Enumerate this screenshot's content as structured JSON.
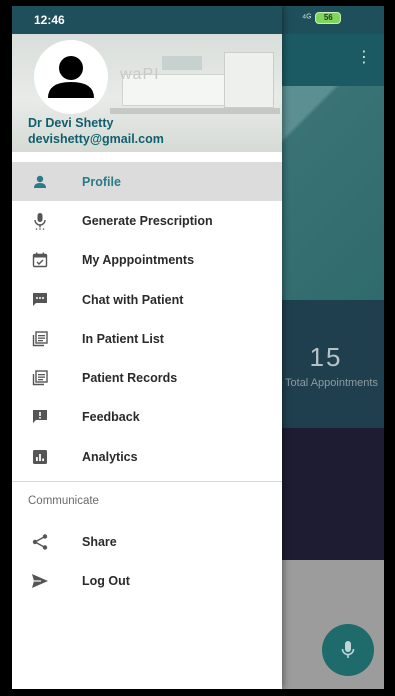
{
  "status_bar": {
    "time": "12:46",
    "signal": "⁴ᴳ",
    "battery": "56"
  },
  "background_app": {
    "menu_glyph": "⋮",
    "total_count": "15",
    "total_label": "Total Appointments"
  },
  "drawer": {
    "header": {
      "doctor_name": "Dr Devi Shetty",
      "doctor_email": "devishetty@gmail.com",
      "watermark": "waPI"
    },
    "menu_items": [
      {
        "label": "Profile",
        "icon": "person-icon",
        "active": true
      },
      {
        "label": "Generate Prescription",
        "icon": "microphone-icon",
        "active": false
      },
      {
        "label": "My Apppointments",
        "icon": "calendar-check-icon",
        "active": false
      },
      {
        "label": "Chat with Patient",
        "icon": "chat-bubble-icon",
        "active": false
      },
      {
        "label": "In Patient List",
        "icon": "list-icon",
        "active": false
      },
      {
        "label": "Patient Records",
        "icon": "records-icon",
        "active": false
      },
      {
        "label": "Feedback",
        "icon": "feedback-icon",
        "active": false
      },
      {
        "label": "Analytics",
        "icon": "analytics-icon",
        "active": false
      }
    ],
    "section_title": "Communicate",
    "communicate_items": [
      {
        "label": "Share",
        "icon": "share-icon"
      },
      {
        "label": "Log Out",
        "icon": "send-icon"
      }
    ]
  },
  "colors": {
    "accent": "#2a7b8a",
    "primary_dark": "#1f4f5a",
    "active_bg": "#dcdcdc"
  }
}
